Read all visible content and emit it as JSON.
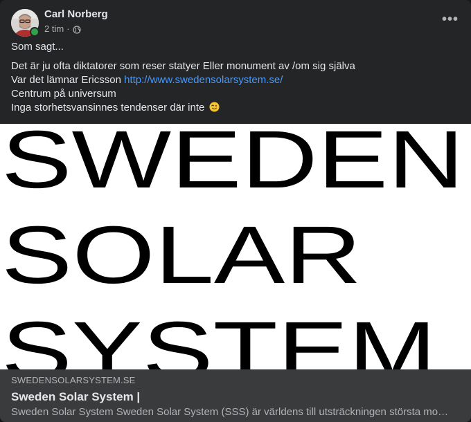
{
  "post": {
    "author": {
      "name": "Carl Norberg",
      "avatar_icon": "profile-photo",
      "online": true,
      "online_color": "#31a24c"
    },
    "meta": {
      "timestamp": "2 tim",
      "separator": "·",
      "audience_icon": "globe-icon"
    },
    "more_icon": "more-options-icon",
    "text": {
      "line1": "Som sagt...",
      "line2": "Det är ju ofta diktatorer som reser statyer Eller monument av /om sig själva",
      "line3_prefix": "Var det lämnar Ericsson ",
      "line3_link": "http://www.swedensolarsystem.se/",
      "line4": "Centrum på universum",
      "line5": "Inga storhetsvansinnes tendenser där inte",
      "emoji": "winking-face"
    },
    "link_preview": {
      "image_lines": [
        "SWEDEN",
        "SOLAR",
        "SYSTEM"
      ],
      "domain": "SWEDENSOLARSYSTEM.SE",
      "title": "Sweden Solar System |",
      "description": "Sweden Solar System Sweden Solar System (SSS) är världens till utsträckningen största modell av solsystemet"
    },
    "colors": {
      "background": "#242526",
      "text": "#e4e6eb",
      "secondary_text": "#b0b3b8",
      "link": "#4599ff",
      "preview_info_bg": "#3a3b3c"
    }
  }
}
